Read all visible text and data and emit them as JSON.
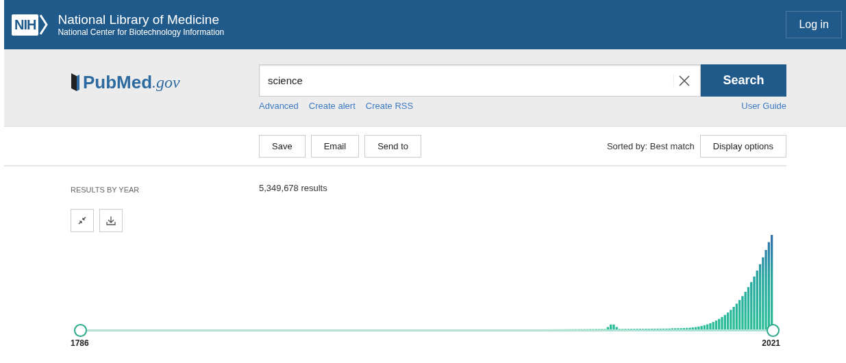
{
  "header": {
    "badge": "NIH",
    "title": "National Library of Medicine",
    "subtitle": "National Center for Biotechnology Information",
    "login": "Log in"
  },
  "logo": {
    "name": "PubMed",
    "suffix": ".gov"
  },
  "search": {
    "value": "science",
    "button": "Search",
    "links": [
      "Advanced",
      "Create alert",
      "Create RSS"
    ],
    "guide": "User Guide"
  },
  "toolbar": {
    "buttons": [
      "Save",
      "Email",
      "Send to"
    ],
    "sorted": "Sorted by: Best match",
    "display": "Display options"
  },
  "timeline": {
    "label": "RESULTS BY YEAR",
    "count": "5,349,678 results",
    "start": "1786",
    "end": "2021",
    "handles": [
      {
        "level": 0
      },
      {
        "level": 1
      }
    ]
  }
}
